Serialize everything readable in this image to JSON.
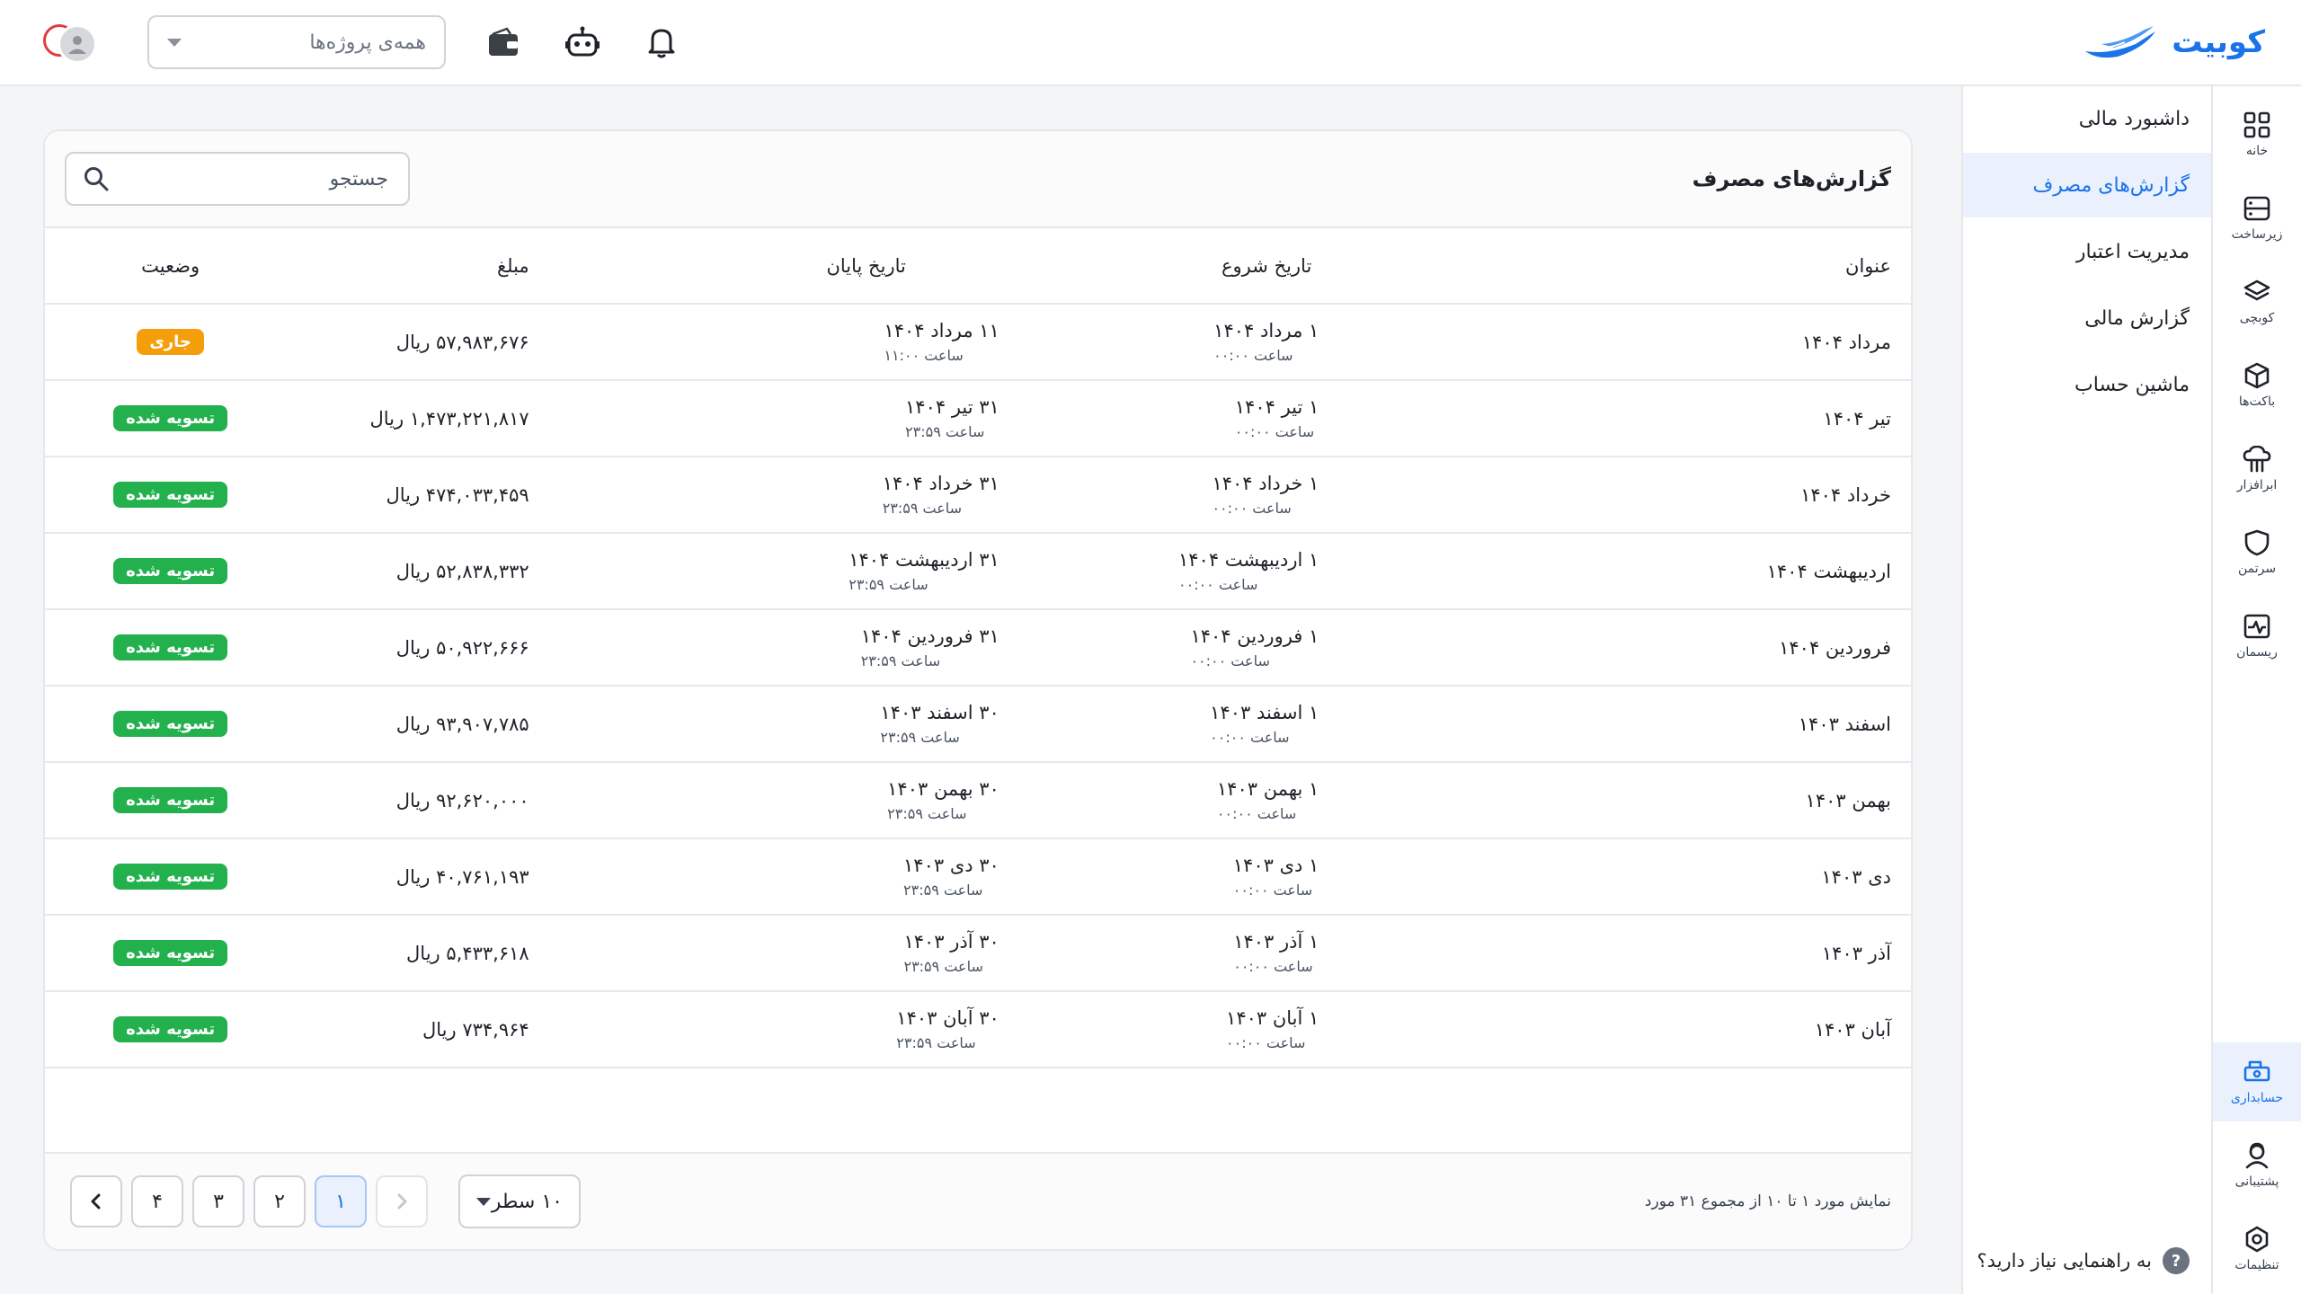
{
  "header": {
    "brand": "کوبیت",
    "project_select_placeholder": "همه‌ی پروژه‌ها"
  },
  "rail": [
    {
      "label": "خانه",
      "icon": "grid-icon"
    },
    {
      "label": "زیرساخت",
      "icon": "server-icon"
    },
    {
      "label": "کوبچی",
      "icon": "layers-icon"
    },
    {
      "label": "باکت‌ها",
      "icon": "box-icon"
    },
    {
      "label": "ابرافزار",
      "icon": "cloud-app-icon"
    },
    {
      "label": "سرتمن",
      "icon": "shield-icon"
    },
    {
      "label": "ریسمان",
      "icon": "pulse-icon"
    },
    {
      "label": "حسابداری",
      "icon": "cash-icon",
      "active": true
    },
    {
      "label": "پشتیبانی",
      "icon": "support-icon"
    },
    {
      "label": "تنظیمات",
      "icon": "settings-icon"
    }
  ],
  "subnav": {
    "items": [
      {
        "label": "داشبورد مالی"
      },
      {
        "label": "گزارش‌های مصرف",
        "active": true
      },
      {
        "label": "مدیریت اعتبار"
      },
      {
        "label": "گزارش مالی"
      },
      {
        "label": "ماشین حساب"
      }
    ],
    "help_label": "به راهنمایی نیاز دارید؟"
  },
  "card": {
    "title": "گزارش‌های مصرف",
    "search_placeholder": "جستجو"
  },
  "table": {
    "headers": {
      "title": "عنوان",
      "start": "تاریخ شروع",
      "end": "تاریخ پایان",
      "amount": "مبلغ",
      "status": "وضعیت"
    },
    "rows": [
      {
        "title": "مرداد ۱۴۰۴",
        "start_date": "۱ مرداد ۱۴۰۴",
        "start_time": "ساعت ۰۰:۰۰",
        "end_date": "۱۱ مرداد ۱۴۰۴",
        "end_time": "ساعت ۱۱:۰۰",
        "amount": "۵۷,۹۸۳,۶۷۶ ریال",
        "status": "جاری",
        "status_color": "#f59e0b"
      },
      {
        "title": "تیر ۱۴۰۴",
        "start_date": "۱ تیر ۱۴۰۴",
        "start_time": "ساعت ۰۰:۰۰",
        "end_date": "۳۱ تیر ۱۴۰۴",
        "end_time": "ساعت ۲۳:۵۹",
        "amount": "۱,۴۷۳,۲۲۱,۸۱۷ ریال",
        "status": "تسویه شده",
        "status_color": "#22b14c"
      },
      {
        "title": "خرداد ۱۴۰۴",
        "start_date": "۱ خرداد ۱۴۰۴",
        "start_time": "ساعت ۰۰:۰۰",
        "end_date": "۳۱ خرداد ۱۴۰۴",
        "end_time": "ساعت ۲۳:۵۹",
        "amount": "۴۷۴,۰۳۳,۴۵۹ ریال",
        "status": "تسویه شده",
        "status_color": "#22b14c"
      },
      {
        "title": "اردیبهشت ۱۴۰۴",
        "start_date": "۱ اردیبهشت ۱۴۰۴",
        "start_time": "ساعت ۰۰:۰۰",
        "end_date": "۳۱ اردیبهشت ۱۴۰۴",
        "end_time": "ساعت ۲۳:۵۹",
        "amount": "۵۲,۸۳۸,۳۳۲ ریال",
        "status": "تسویه شده",
        "status_color": "#22b14c"
      },
      {
        "title": "فروردین ۱۴۰۴",
        "start_date": "۱ فروردین ۱۴۰۴",
        "start_time": "ساعت ۰۰:۰۰",
        "end_date": "۳۱ فروردین ۱۴۰۴",
        "end_time": "ساعت ۲۳:۵۹",
        "amount": "۵۰,۹۲۲,۶۶۶ ریال",
        "status": "تسویه شده",
        "status_color": "#22b14c"
      },
      {
        "title": "اسفند ۱۴۰۳",
        "start_date": "۱ اسفند ۱۴۰۳",
        "start_time": "ساعت ۰۰:۰۰",
        "end_date": "۳۰ اسفند ۱۴۰۳",
        "end_time": "ساعت ۲۳:۵۹",
        "amount": "۹۳,۹۰۷,۷۸۵ ریال",
        "status": "تسویه شده",
        "status_color": "#22b14c"
      },
      {
        "title": "بهمن ۱۴۰۳",
        "start_date": "۱ بهمن ۱۴۰۳",
        "start_time": "ساعت ۰۰:۰۰",
        "end_date": "۳۰ بهمن ۱۴۰۳",
        "end_time": "ساعت ۲۳:۵۹",
        "amount": "۹۲,۶۲۰,۰۰۰ ریال",
        "status": "تسویه شده",
        "status_color": "#22b14c"
      },
      {
        "title": "دی ۱۴۰۳",
        "start_date": "۱ دی ۱۴۰۳",
        "start_time": "ساعت ۰۰:۰۰",
        "end_date": "۳۰ دی ۱۴۰۳",
        "end_time": "ساعت ۲۳:۵۹",
        "amount": "۴۰,۷۶۱,۱۹۳ ریال",
        "status": "تسویه شده",
        "status_color": "#22b14c"
      },
      {
        "title": "آذر ۱۴۰۳",
        "start_date": "۱ آذر ۱۴۰۳",
        "start_time": "ساعت ۰۰:۰۰",
        "end_date": "۳۰ آذر ۱۴۰۳",
        "end_time": "ساعت ۲۳:۵۹",
        "amount": "۵,۴۳۳,۶۱۸ ریال",
        "status": "تسویه شده",
        "status_color": "#22b14c"
      },
      {
        "title": "آبان ۱۴۰۳",
        "start_date": "۱ آبان ۱۴۰۳",
        "start_time": "ساعت ۰۰:۰۰",
        "end_date": "۳۰ آبان ۱۴۰۳",
        "end_time": "ساعت ۲۳:۵۹",
        "amount": "۷۳۴,۹۶۴ ریال",
        "status": "تسویه شده",
        "status_color": "#22b14c"
      }
    ]
  },
  "footer": {
    "summary": "نمایش مورد ۱ تا ۱۰ از مجموع ۳۱ مورد",
    "rows_per_page": "۱۰ سطر",
    "pages": [
      "۱",
      "۲",
      "۳",
      "۴"
    ],
    "current_page": "۱"
  }
}
